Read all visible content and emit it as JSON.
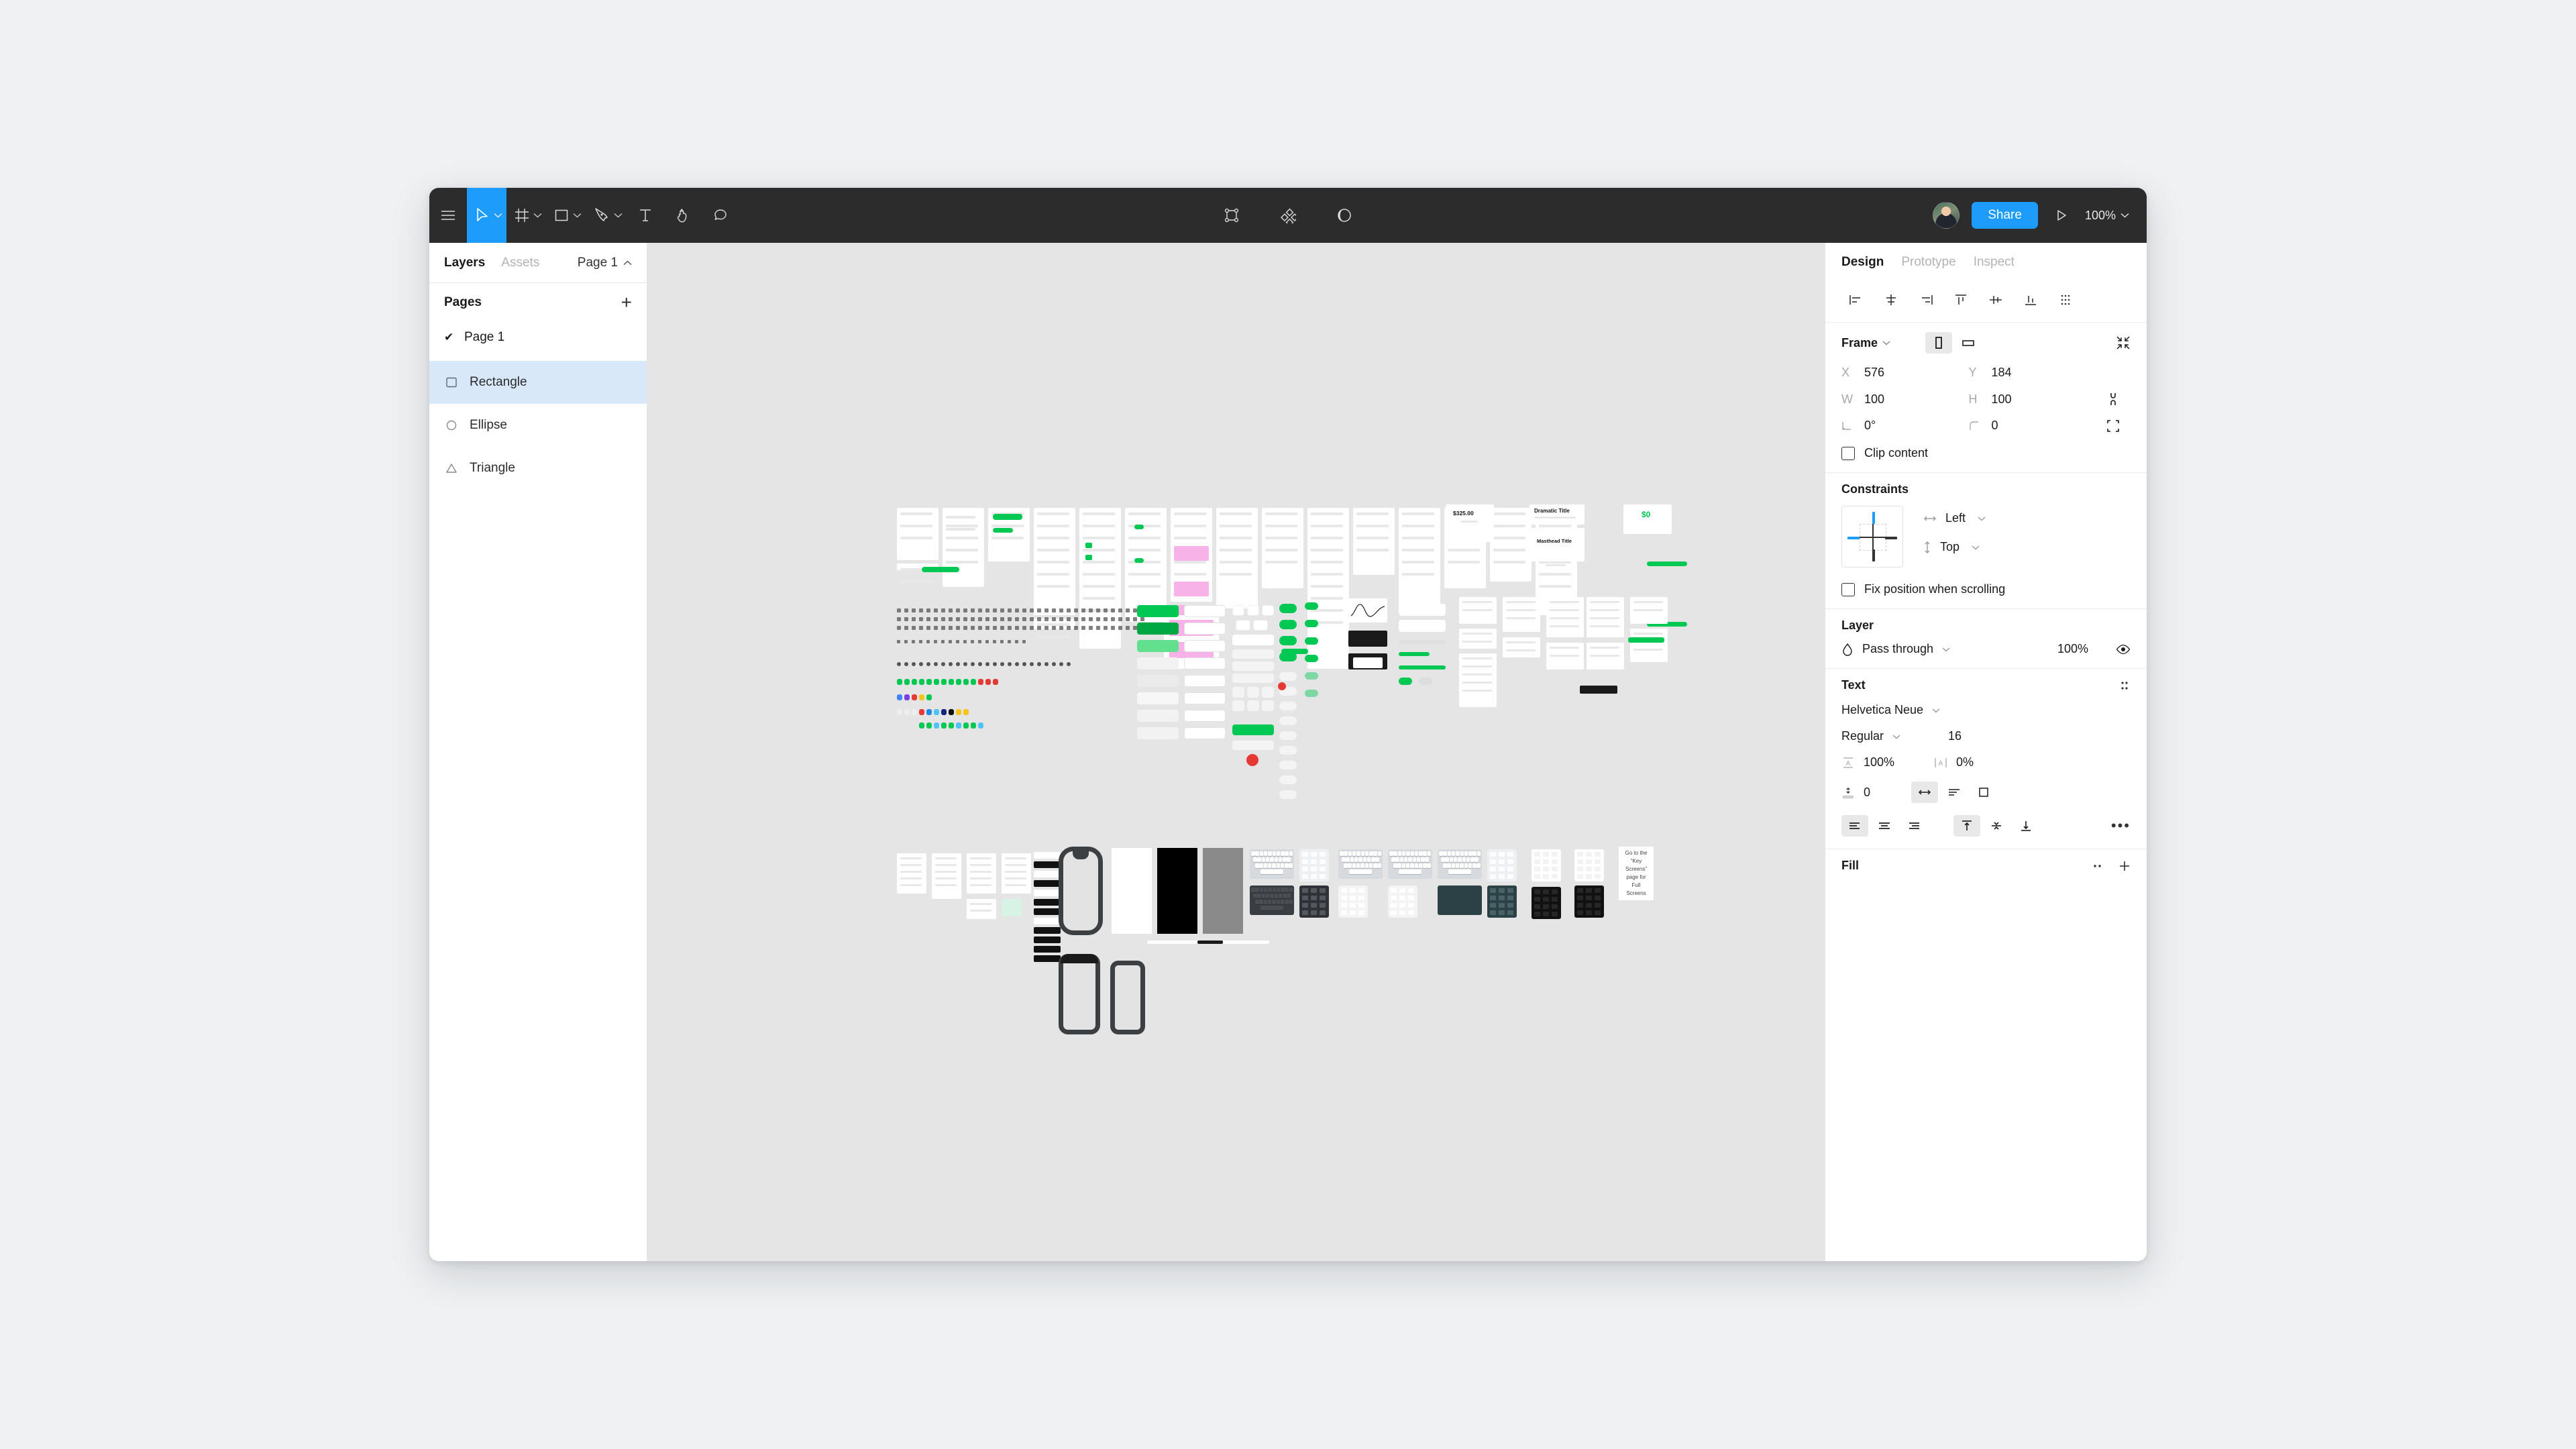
{
  "toolbar": {
    "menu_icon": "hamburger-menu-icon",
    "tools": [
      {
        "name": "move-tool",
        "icon": "cursor-arrow-icon",
        "active": true,
        "has_dropdown": true
      },
      {
        "name": "frame-tool",
        "icon": "frame-grid-icon",
        "active": false,
        "has_dropdown": true
      },
      {
        "name": "shape-tool",
        "icon": "rectangle-icon",
        "active": false,
        "has_dropdown": true
      },
      {
        "name": "pen-tool",
        "icon": "pen-nib-icon",
        "active": false,
        "has_dropdown": true
      },
      {
        "name": "text-tool",
        "icon": "text-t-icon",
        "active": false,
        "has_dropdown": false
      },
      {
        "name": "hand-tool",
        "icon": "hand-icon",
        "active": false,
        "has_dropdown": false
      },
      {
        "name": "comment-tool",
        "icon": "comment-bubble-icon",
        "active": false,
        "has_dropdown": false
      }
    ],
    "center_tools": [
      {
        "name": "scale-node-tool",
        "icon": "vector-node-square-icon"
      },
      {
        "name": "components-tool",
        "icon": "four-diamonds-icon"
      },
      {
        "name": "contrast-tool",
        "icon": "half-moon-contrast-icon"
      }
    ],
    "avatar": "user-avatar",
    "share_label": "Share",
    "present_icon": "play-triangle-icon",
    "zoom_level": "100%",
    "zoom_chevron": "chevron-down-icon"
  },
  "left_panel": {
    "tabs": [
      {
        "label": "Layers",
        "active": true
      },
      {
        "label": "Assets",
        "active": false
      }
    ],
    "page_selector": {
      "label": "Page 1",
      "icon": "chevron-up-icon"
    },
    "pages_header": "Pages",
    "add_page_icon": "plus-icon",
    "pages": [
      {
        "label": "Page 1",
        "checked": true
      }
    ],
    "layers": [
      {
        "label": "Rectangle",
        "icon": "rectangle-layer-icon",
        "selected": true
      },
      {
        "label": "Ellipse",
        "icon": "ellipse-layer-icon",
        "selected": false
      },
      {
        "label": "Triangle",
        "icon": "triangle-layer-icon",
        "selected": false
      }
    ]
  },
  "right_panel": {
    "tabs": [
      {
        "label": "Design",
        "active": true
      },
      {
        "label": "Prototype",
        "active": false
      },
      {
        "label": "Inspect",
        "active": false
      }
    ],
    "align_buttons": [
      {
        "name": "align-left",
        "icon": "align-left-icon"
      },
      {
        "name": "align-horizontal-center",
        "icon": "align-horizontal-center-icon"
      },
      {
        "name": "align-right",
        "icon": "align-right-icon"
      },
      {
        "name": "align-top",
        "icon": "align-top-icon"
      },
      {
        "name": "align-vertical-center",
        "icon": "align-vertical-center-icon"
      },
      {
        "name": "align-bottom",
        "icon": "align-bottom-icon"
      },
      {
        "name": "distribute",
        "icon": "distribute-grid-icon"
      }
    ],
    "frame": {
      "title": "Frame",
      "chevron": "chevron-down-icon",
      "orientation_portrait": "portrait-icon",
      "orientation_landscape": "landscape-icon",
      "portrait_active": true,
      "resize_icon": "resize-to-fit-icon",
      "x_label": "X",
      "x_value": "576",
      "y_label": "Y",
      "y_value": "184",
      "w_label": "W",
      "w_value": "100",
      "h_label": "H",
      "h_value": "100",
      "rotation_label": "rotation-icon",
      "rotation_value": "0°",
      "corner_label": "corner-radius-icon",
      "corner_value": "0",
      "ratio_lock_icon": "proportion-lock-icon",
      "independent_corners_icon": "independent-corners-icon",
      "clip_content_label": "Clip content",
      "clip_content_checked": false
    },
    "constraints": {
      "title": "Constraints",
      "horizontal_icon": "horizontal-arrows-icon",
      "horizontal_value": "Left",
      "vertical_icon": "vertical-arrows-icon",
      "vertical_value": "Top",
      "chevron": "chevron-down-icon",
      "fix_position_label": "Fix position when scrolling",
      "fix_position_checked": false,
      "active_edges": [
        "top",
        "left"
      ],
      "accent": "#1e9cfb"
    },
    "layer": {
      "title": "Layer",
      "blend_icon": "blend-mode-droplet-icon",
      "blend_mode": "Pass through",
      "opacity": "100%",
      "visibility_icon": "eye-icon",
      "chevron": "chevron-down-icon"
    },
    "text": {
      "title": "Text",
      "settings_icon": "type-settings-dots-icon",
      "font_family": "Helvetica Neue",
      "font_style": "Regular",
      "font_size": "16",
      "line_height_icon": "line-height-icon",
      "line_height": "100%",
      "letter_spacing_icon": "letter-spacing-icon",
      "letter_spacing": "0%",
      "paragraph_spacing_icon": "paragraph-spacing-icon",
      "paragraph_spacing": "0",
      "resize_options": [
        {
          "name": "auto-width",
          "icon": "auto-width-icon",
          "active": true
        },
        {
          "name": "auto-height",
          "icon": "auto-height-icon",
          "active": false
        },
        {
          "name": "fixed-size",
          "icon": "fixed-size-icon",
          "active": false
        }
      ],
      "h_align": [
        {
          "name": "text-align-left",
          "icon": "text-align-left-icon",
          "active": true
        },
        {
          "name": "text-align-center",
          "icon": "text-align-center-icon",
          "active": false
        },
        {
          "name": "text-align-right",
          "icon": "text-align-right-icon",
          "active": false
        }
      ],
      "v_align": [
        {
          "name": "text-align-top",
          "icon": "text-align-top-icon",
          "active": true
        },
        {
          "name": "text-align-middle",
          "icon": "text-align-middle-icon",
          "active": false
        },
        {
          "name": "text-align-bottom",
          "icon": "text-align-bottom-icon",
          "active": false
        }
      ],
      "more_icon": "more-horizontal-icon"
    },
    "fill": {
      "title": "Fill",
      "styles_icon": "fill-styles-dots-icon",
      "add_icon": "plus-icon"
    }
  },
  "canvas": {
    "background": "#e5e5e5",
    "accent_green": "#00c853",
    "accent_pink": "#f7b3e8",
    "labels": {
      "amount_large": "$325.00",
      "amount_zero": "$0",
      "dramatic_title": "Dramatic Title",
      "masthead_title": "Masthead Title",
      "key_screens_note": "Go to the “Key Screens” page for Full Screens"
    }
  }
}
